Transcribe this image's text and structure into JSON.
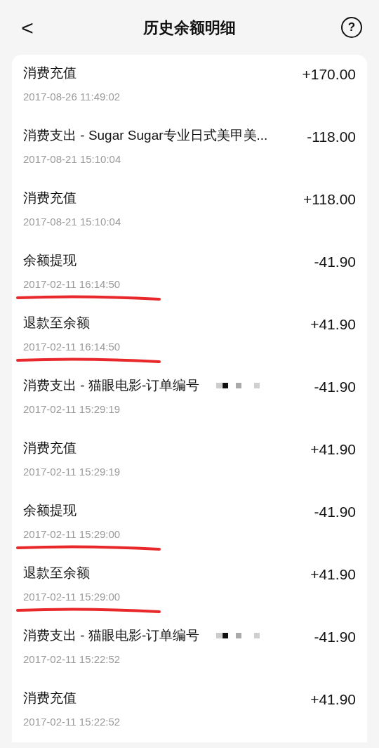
{
  "header": {
    "back": "<",
    "title": "历史余额明细",
    "help": "?"
  },
  "records": [
    {
      "title": "消费充值",
      "time": "2017-08-26 11:49:02",
      "amount": "+170.00",
      "underlined": false,
      "redacted": false
    },
    {
      "title": "消费支出 - Sugar Sugar专业日式美甲美...",
      "time": "2017-08-21 15:10:04",
      "amount": "-118.00",
      "underlined": false,
      "redacted": false
    },
    {
      "title": "消费充值",
      "time": "2017-08-21 15:10:04",
      "amount": "+118.00",
      "underlined": false,
      "redacted": false
    },
    {
      "title": "余额提现",
      "time": "2017-02-11 16:14:50",
      "amount": "-41.90",
      "underlined": true,
      "redacted": false
    },
    {
      "title": "退款至余额",
      "time": "2017-02-11 16:14:50",
      "amount": "+41.90",
      "underlined": true,
      "redacted": false
    },
    {
      "title": "消费支出 - 猫眼电影-订单编号",
      "time": "2017-02-11 15:29:19",
      "amount": "-41.90",
      "underlined": false,
      "redacted": true
    },
    {
      "title": "消费充值",
      "time": "2017-02-11 15:29:19",
      "amount": "+41.90",
      "underlined": false,
      "redacted": false
    },
    {
      "title": "余额提现",
      "time": "2017-02-11 15:29:00",
      "amount": "-41.90",
      "underlined": true,
      "redacted": false
    },
    {
      "title": "退款至余额",
      "time": "2017-02-11 15:29:00",
      "amount": "+41.90",
      "underlined": true,
      "redacted": false
    },
    {
      "title": "消费支出 - 猫眼电影-订单编号",
      "time": "2017-02-11 15:22:52",
      "amount": "-41.90",
      "underlined": false,
      "redacted": true
    },
    {
      "title": "消费充值",
      "time": "2017-02-11 15:22:52",
      "amount": "+41.90",
      "underlined": false,
      "redacted": false
    }
  ]
}
